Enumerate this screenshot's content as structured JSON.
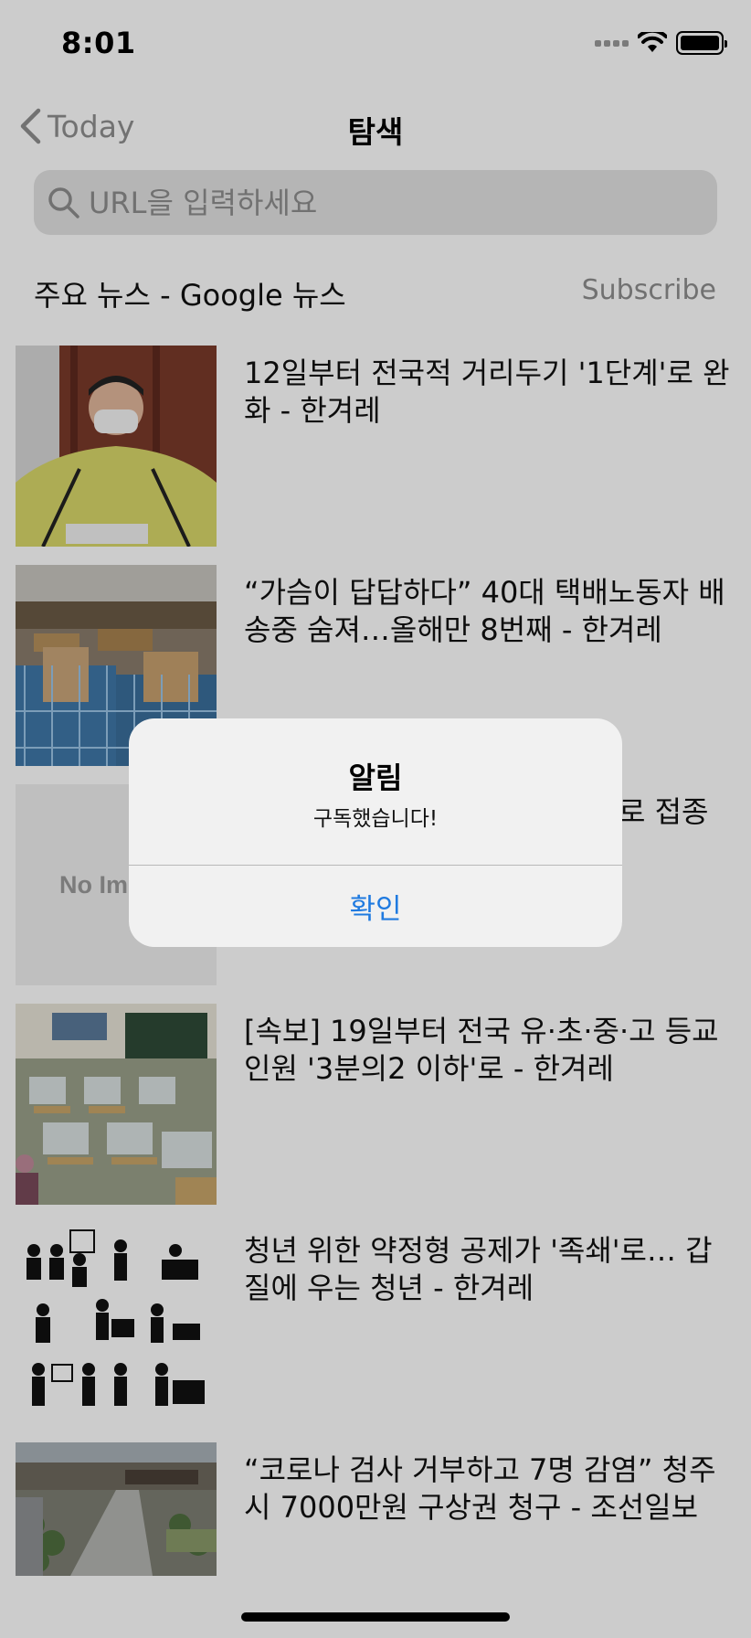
{
  "status": {
    "time": "8:01"
  },
  "nav": {
    "back_label": "Today",
    "title": "탐색"
  },
  "search": {
    "placeholder": "URL을 입력하세요"
  },
  "feed": {
    "title": "주요 뉴스 - Google 뉴스",
    "subscribe_label": "Subscribe"
  },
  "articles": [
    {
      "title": "12일부터 전국적 거리두기 '1단계'로 완화 - 한겨레"
    },
    {
      "title": "“가슴이 답답하다” 40대 택배노동자 배송중 숨져…올해만 8번째 - 한겨레"
    },
    {
      "title": "로 접종",
      "thumb_text": "No Im"
    },
    {
      "title": "[속보] 19일부터 전국 유·초·중·고 등교인원 '3분의2 이하'로 - 한겨레"
    },
    {
      "title": "청년 위한 약정형 공제가 '족쇄'로… 갑질에 우는 청년 - 한겨레"
    },
    {
      "title": "“코로나 검사 거부하고 7명 감염” 청주시 7000만원 구상권 청구 - 조선일보"
    }
  ],
  "alert": {
    "title": "알림",
    "message": "구독했습니다!",
    "confirm_label": "확인"
  },
  "colors": {
    "accent": "#1f7ae0",
    "dim_overlay": "rgba(0,0,0,0.2)",
    "secondary_text": "#8e8e8e"
  }
}
